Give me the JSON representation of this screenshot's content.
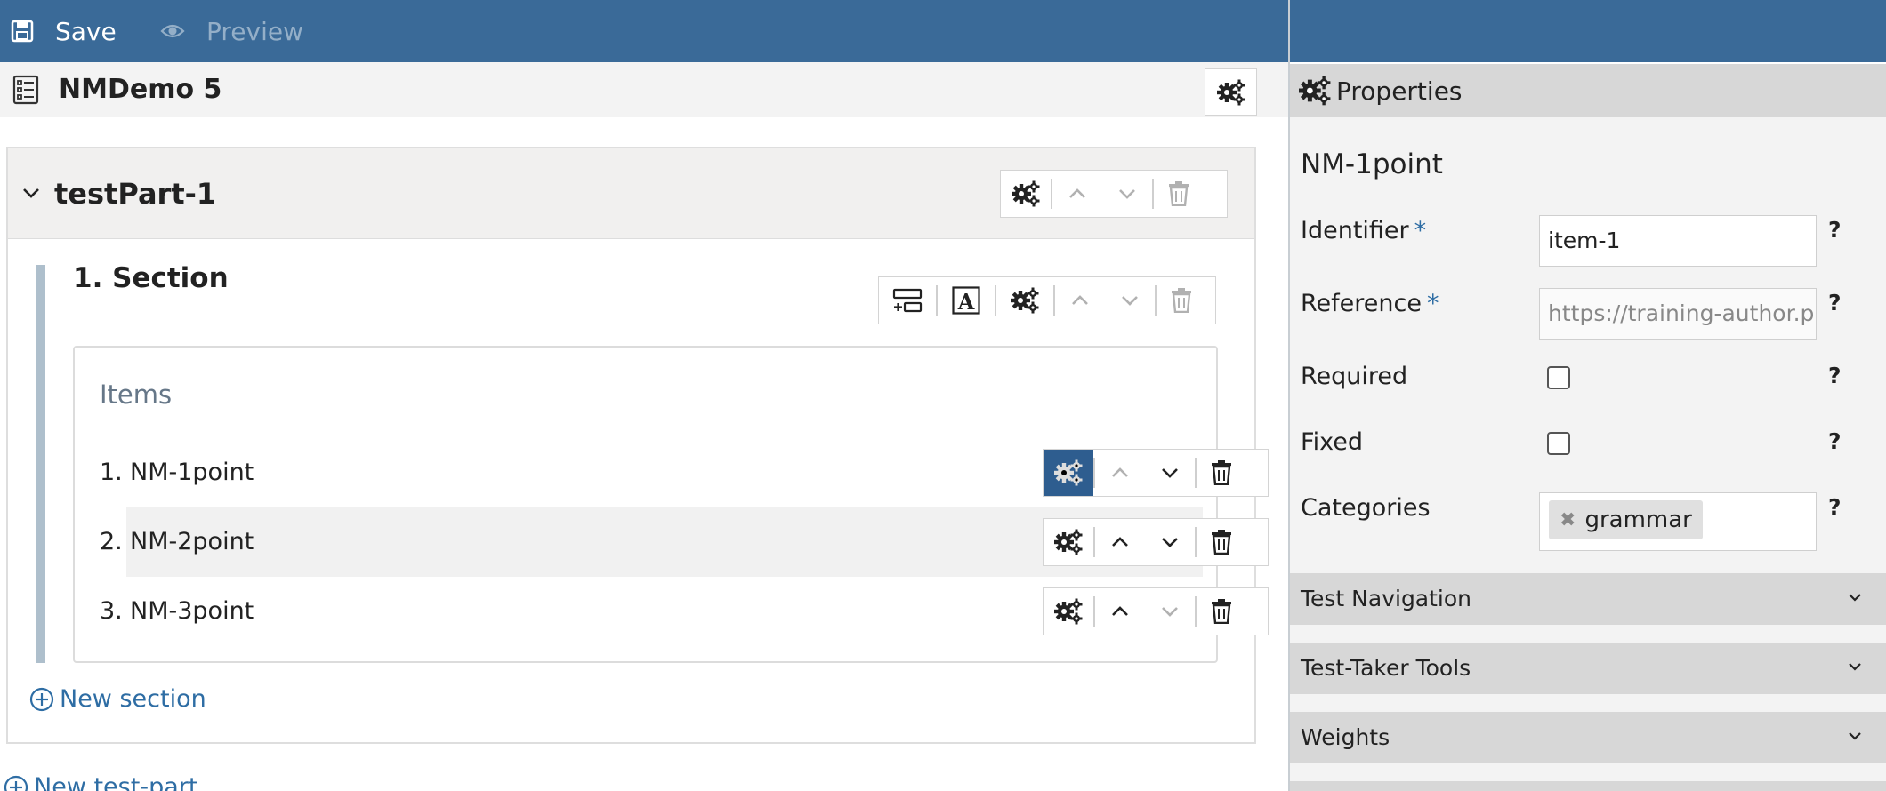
{
  "toolbar": {
    "save_label": "Save",
    "preview_label": "Preview"
  },
  "test": {
    "title": "NMDemo 5"
  },
  "test_part": {
    "title": "testPart-1",
    "section": {
      "title": "1. Section",
      "items_heading": "Items",
      "items": [
        {
          "number": "1.",
          "label": "NM-1point"
        },
        {
          "number": "2.",
          "label": "NM-2point"
        },
        {
          "number": "3.",
          "label": "NM-3point"
        }
      ]
    },
    "new_section_label": "New section"
  },
  "new_test_part_label": "New test-part",
  "properties": {
    "header": "Properties",
    "item_name": "NM-1point",
    "identifier_label": "Identifier",
    "identifier_value": "item-1",
    "reference_label": "Reference",
    "reference_value": "https://training-author.prc",
    "required_label": "Required",
    "fixed_label": "Fixed",
    "categories_label": "Categories",
    "category_tag": "grammar",
    "required_mark": "*",
    "help_mark": "?",
    "sections": [
      {
        "label": "Test Navigation"
      },
      {
        "label": "Test-Taker Tools"
      },
      {
        "label": "Weights"
      }
    ]
  },
  "colors": {
    "topbar": "#3a6a98",
    "accent": "#2e5d8f",
    "link": "#2e6da4"
  },
  "icons": {
    "save": "floppy-disk-icon",
    "preview": "eye-icon",
    "settings": "gears-icon",
    "move_up": "chevron-up-icon",
    "move_down": "chevron-down-icon",
    "delete": "trash-icon",
    "add_subsection": "add-subsection-icon",
    "rubric": "rubric-block-icon",
    "add": "plus-circle-icon"
  }
}
